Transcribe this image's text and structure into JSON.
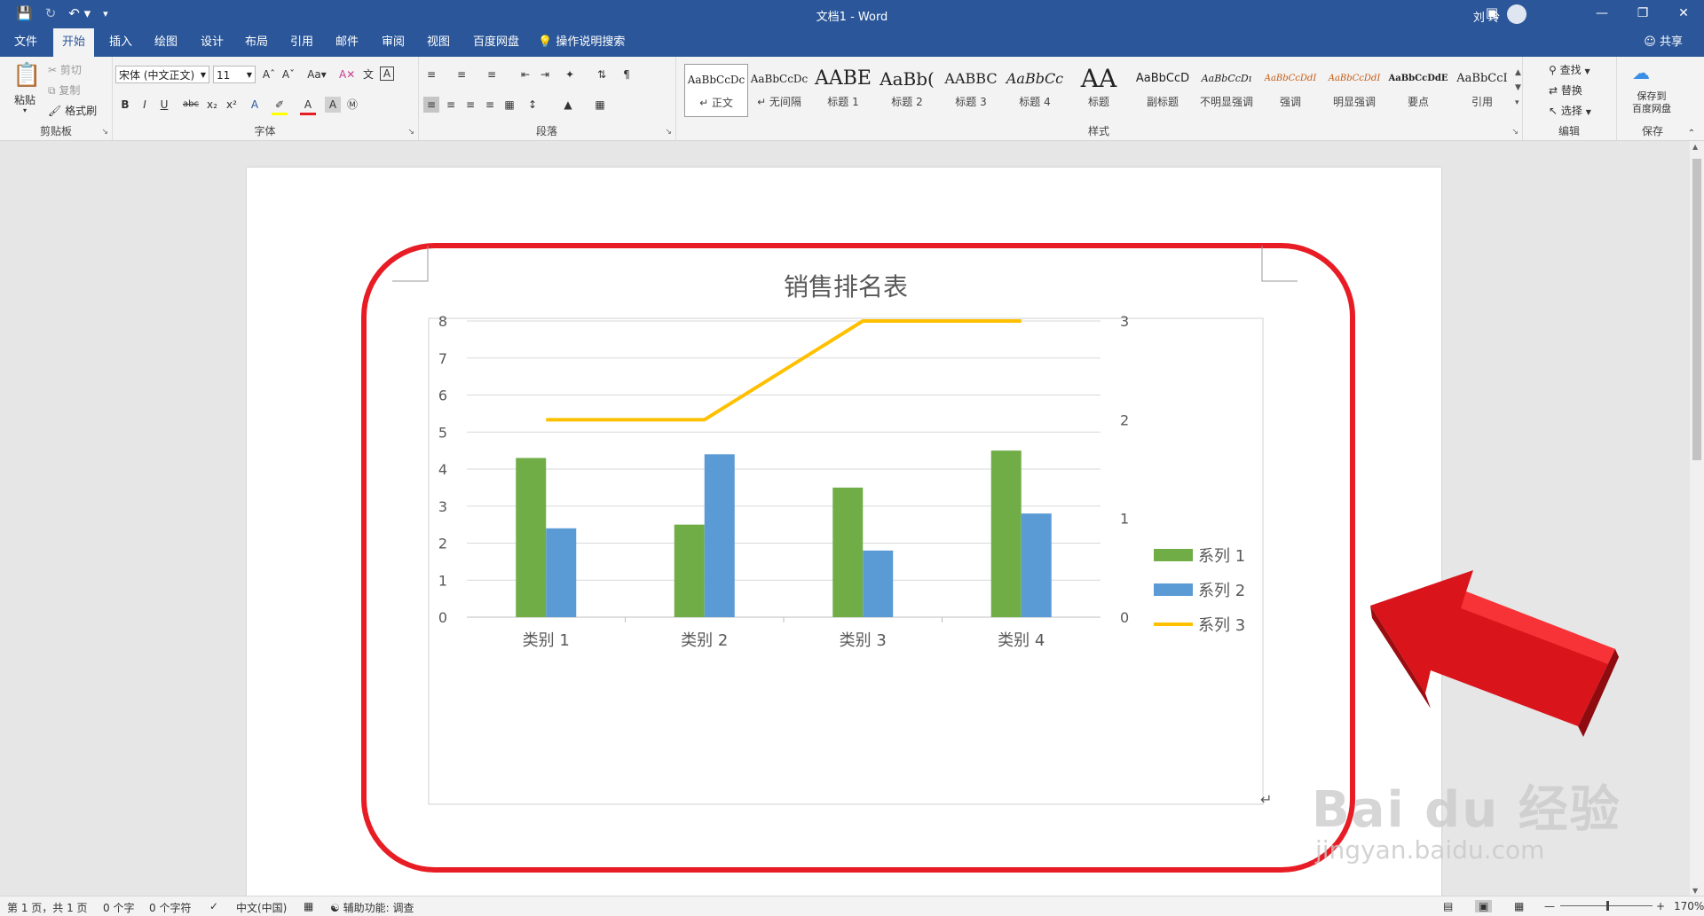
{
  "titlebar": {
    "qat": {
      "save_icon": "save-icon",
      "autosave_icon": "autosave-icon",
      "undo_icon": "undo-icon",
      "customize_icon": "qat-customize-icon"
    },
    "doc_title": "文档1 - Word",
    "user_name": "刘 玲",
    "controls": {
      "ribbon_display": "ribbon-display-icon",
      "minimize": "minimize-icon",
      "restore": "restore-icon",
      "close": "close-icon"
    }
  },
  "tabs": {
    "items": [
      "文件",
      "开始",
      "插入",
      "绘图",
      "设计",
      "布局",
      "引用",
      "邮件",
      "审阅",
      "视图",
      "百度网盘"
    ],
    "active": "开始",
    "search": "操作说明搜索",
    "share": "共享"
  },
  "ribbon": {
    "clipboard": {
      "label": "剪贴板",
      "paste": "粘贴",
      "cut": "剪切",
      "copy": "复制",
      "format_painter": "格式刷"
    },
    "font": {
      "label": "字体",
      "font_name": "宋体 (中文正文)",
      "font_size": "11"
    },
    "paragraph": {
      "label": "段落"
    },
    "styles": {
      "label": "样式",
      "items": [
        {
          "preview": "AaBbCcDc",
          "name": "↵ 正文"
        },
        {
          "preview": "AaBbCcDc",
          "name": "↵ 无间隔"
        },
        {
          "preview": "AABE",
          "name": "标题 1"
        },
        {
          "preview": "AaBb(",
          "name": "标题 2"
        },
        {
          "preview": "AABBC",
          "name": "标题 3"
        },
        {
          "preview": "AaBbCc",
          "name": "标题 4"
        },
        {
          "preview": "AA",
          "name": "标题"
        },
        {
          "preview": "AaBbCcD",
          "name": "副标题"
        },
        {
          "preview": "AaBbCcDı",
          "name": "不明显强调"
        },
        {
          "preview": "AaBbCcDdI",
          "name": "强调"
        },
        {
          "preview": "AaBbCcDdI",
          "name": "明显强调"
        },
        {
          "preview": "AaBbCcDdE",
          "name": "要点"
        },
        {
          "preview": "AaBbCcI",
          "name": "引用"
        }
      ]
    },
    "editing": {
      "label": "编辑",
      "find": "查找",
      "replace": "替换",
      "select": "选择"
    },
    "save": {
      "label": "保存",
      "button": "保存到百度网盘",
      "line1": "保存到",
      "line2": "百度网盘"
    }
  },
  "status": {
    "page": "第 1 页，共 1 页",
    "words": "0 个字",
    "chars": "0 个字符",
    "lang": "中文(中国)",
    "accessibility": "辅助功能: 调查",
    "zoom": "170%"
  },
  "colors": {
    "ribbon_blue": "#2b579a",
    "series1": "#70ad47",
    "series2": "#5b9bd5",
    "series3": "#ffc000",
    "highlight": "#e81c24",
    "arrow": "#d9141b"
  },
  "watermark": {
    "brand": "Bai du 经验",
    "url": "jingyan.baidu.com"
  },
  "chart_data": {
    "type": "bar",
    "title": "销售排名表",
    "categories": [
      "类别 1",
      "类别 2",
      "类别 3",
      "类别 4"
    ],
    "series": [
      {
        "name": "系列 1",
        "type": "bar",
        "axis": "primary",
        "color": "#70ad47",
        "values": [
          4.3,
          2.5,
          3.5,
          4.5
        ]
      },
      {
        "name": "系列 2",
        "type": "bar",
        "axis": "primary",
        "color": "#5b9bd5",
        "values": [
          2.4,
          4.4,
          1.8,
          2.8
        ]
      },
      {
        "name": "系列 3",
        "type": "line",
        "axis": "secondary",
        "color": "#ffc000",
        "values": [
          2,
          2,
          3,
          3
        ]
      }
    ],
    "ylim": [
      0,
      8
    ],
    "yticks": [
      "0",
      "1",
      "2",
      "3",
      "4",
      "5",
      "6",
      "7",
      "8"
    ],
    "y2lim": [
      0,
      3
    ],
    "y2ticks": [
      "0",
      "1",
      "2",
      "3"
    ],
    "grid": true,
    "legend": "right"
  }
}
